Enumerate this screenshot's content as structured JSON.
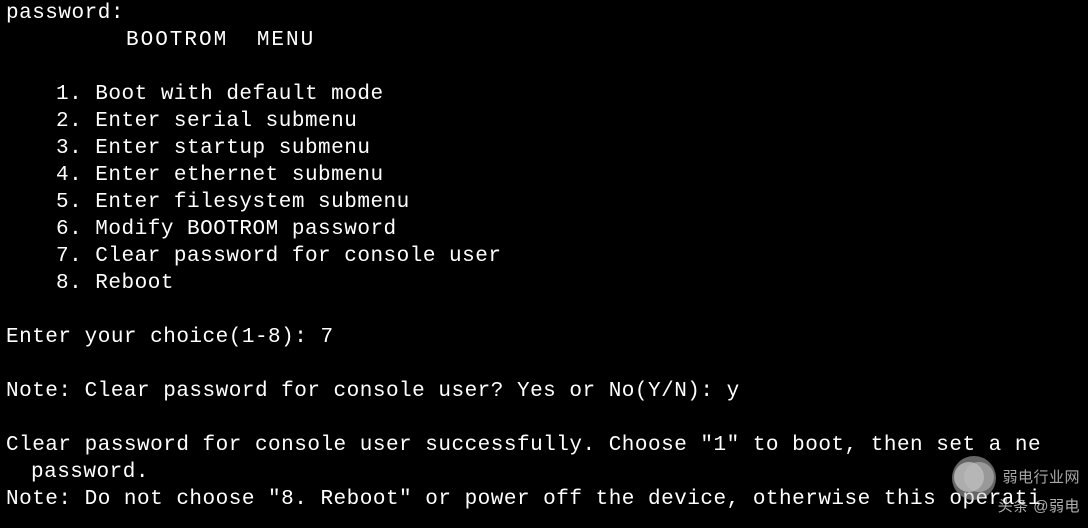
{
  "terminal": {
    "password_prompt": "password:",
    "menu_title": "BOOTROM  MENU",
    "menu_items": [
      "1. Boot with default mode",
      "2. Enter serial submenu",
      "3. Enter startup submenu",
      "4. Enter ethernet submenu",
      "5. Enter filesystem submenu",
      "6. Modify BOOTROM password",
      "7. Clear password for console user",
      "8. Reboot"
    ],
    "choice_prompt": "Enter your choice(1-8): ",
    "choice_input": "7",
    "note_prompt": "Note: Clear password for console user? Yes or No(Y/N): ",
    "note_input": "y",
    "success_line1": "Clear password for console user successfully. Choose \"1\" to boot, then set a ne",
    "success_line2": "password.",
    "warning_line": "Note: Do not choose \"8. Reboot\" or power off the device, otherwise this operati"
  },
  "watermark": {
    "brand": "弱电行业网",
    "source": "头条 @弱电"
  }
}
